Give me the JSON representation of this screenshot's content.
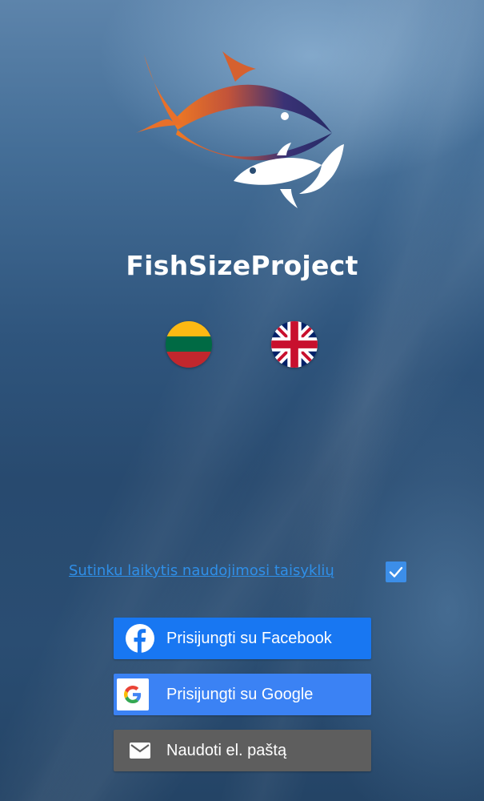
{
  "app": {
    "title": "FishSizeProject"
  },
  "languages": [
    {
      "code": "lt",
      "icon": "lithuania-flag-icon"
    },
    {
      "code": "en",
      "icon": "uk-flag-icon"
    }
  ],
  "terms": {
    "label": "Sutinku laikytis naudojimosi taisyklių",
    "checked": true
  },
  "buttons": {
    "facebook": {
      "label": "Prisijungti su Facebook",
      "icon": "facebook-icon",
      "color": "#1877f2"
    },
    "google": {
      "label": "Prisijungti su Google",
      "icon": "google-icon",
      "color": "#3b82f4"
    },
    "email": {
      "label": "Naudoti el. paštą",
      "icon": "mail-icon",
      "color": "#5e5e5e"
    }
  },
  "colors": {
    "accent": "#2f8fe8",
    "logo_orange": "#e8782a",
    "logo_navy": "#2c2f6b"
  }
}
